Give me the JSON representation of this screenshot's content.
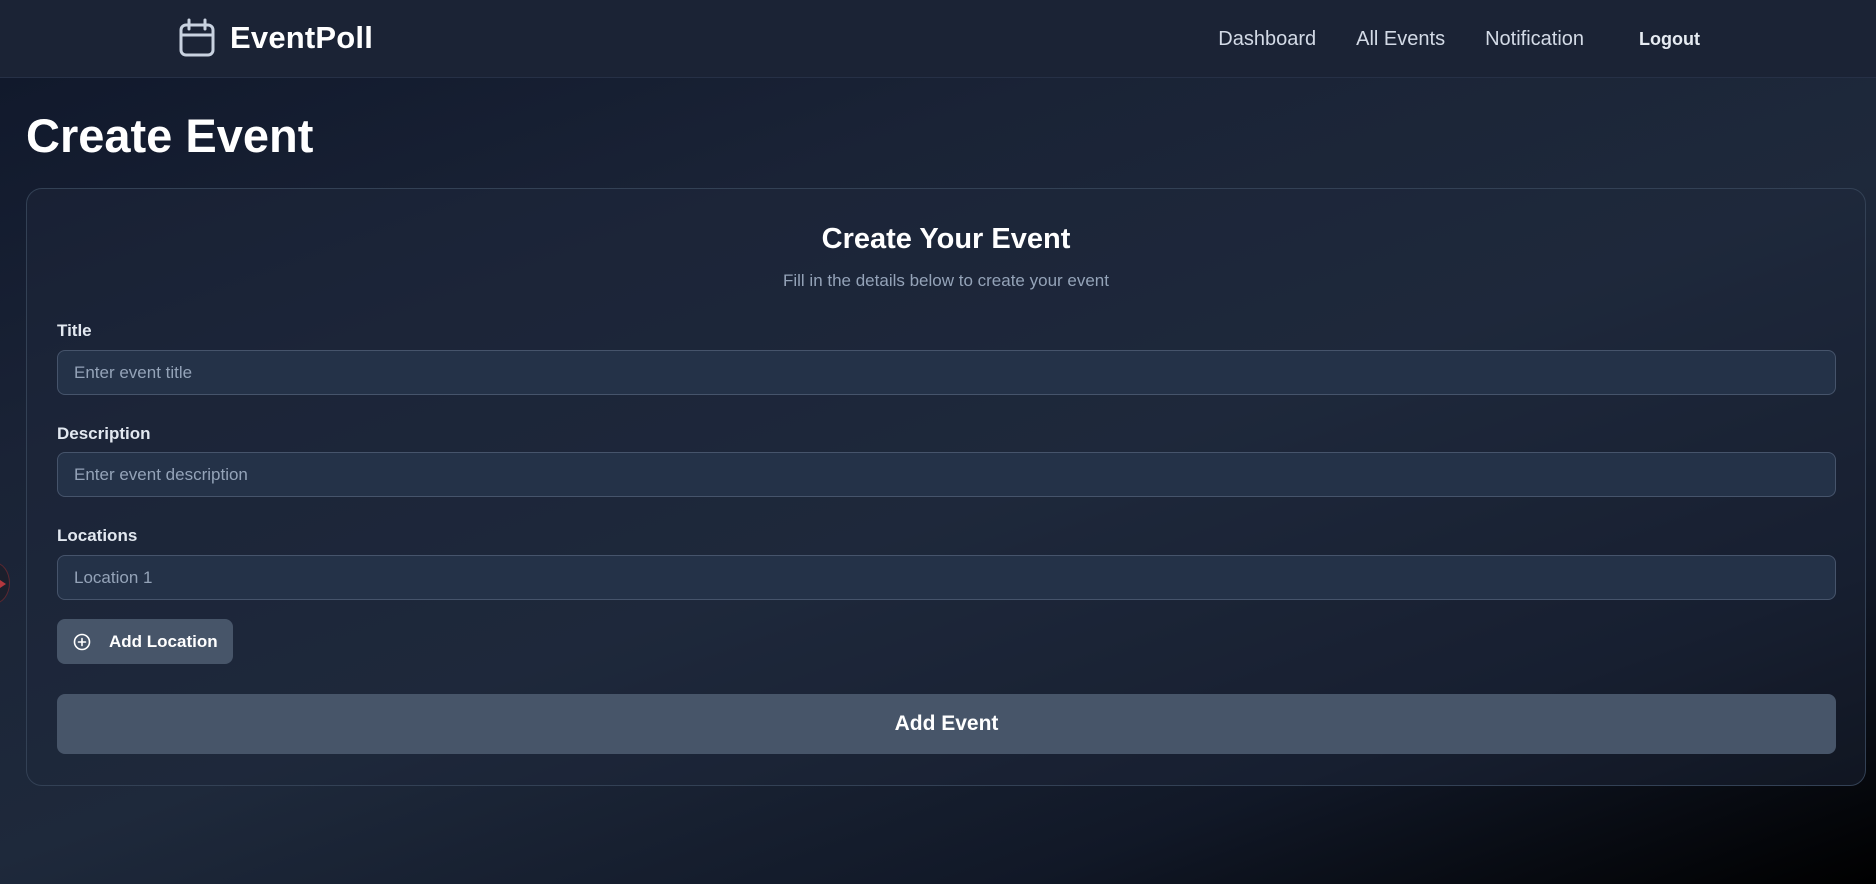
{
  "header": {
    "brand": "EventPoll",
    "nav": [
      "Dashboard",
      "All Events",
      "Notification"
    ],
    "logout_label": "Logout"
  },
  "page": {
    "title": "Create Event"
  },
  "form": {
    "heading": "Create Your Event",
    "subheading": "Fill in the details below to create your event",
    "title_label": "Title",
    "title_placeholder": "Enter event title",
    "title_value": "",
    "description_label": "Description",
    "description_placeholder": "Enter event description",
    "description_value": "",
    "locations_label": "Locations",
    "location_placeholders": [
      "Location 1"
    ],
    "add_location_label": "Add Location",
    "submit_label": "Add Event"
  },
  "icons": {
    "brand": "calendar-icon",
    "add_location": "plus-circle-icon"
  },
  "colors": {
    "background": "#0f172a",
    "navbar": "#1b2335",
    "input_bg": "#243248",
    "button_bg": "#475569",
    "muted_text": "#94a3b8"
  }
}
